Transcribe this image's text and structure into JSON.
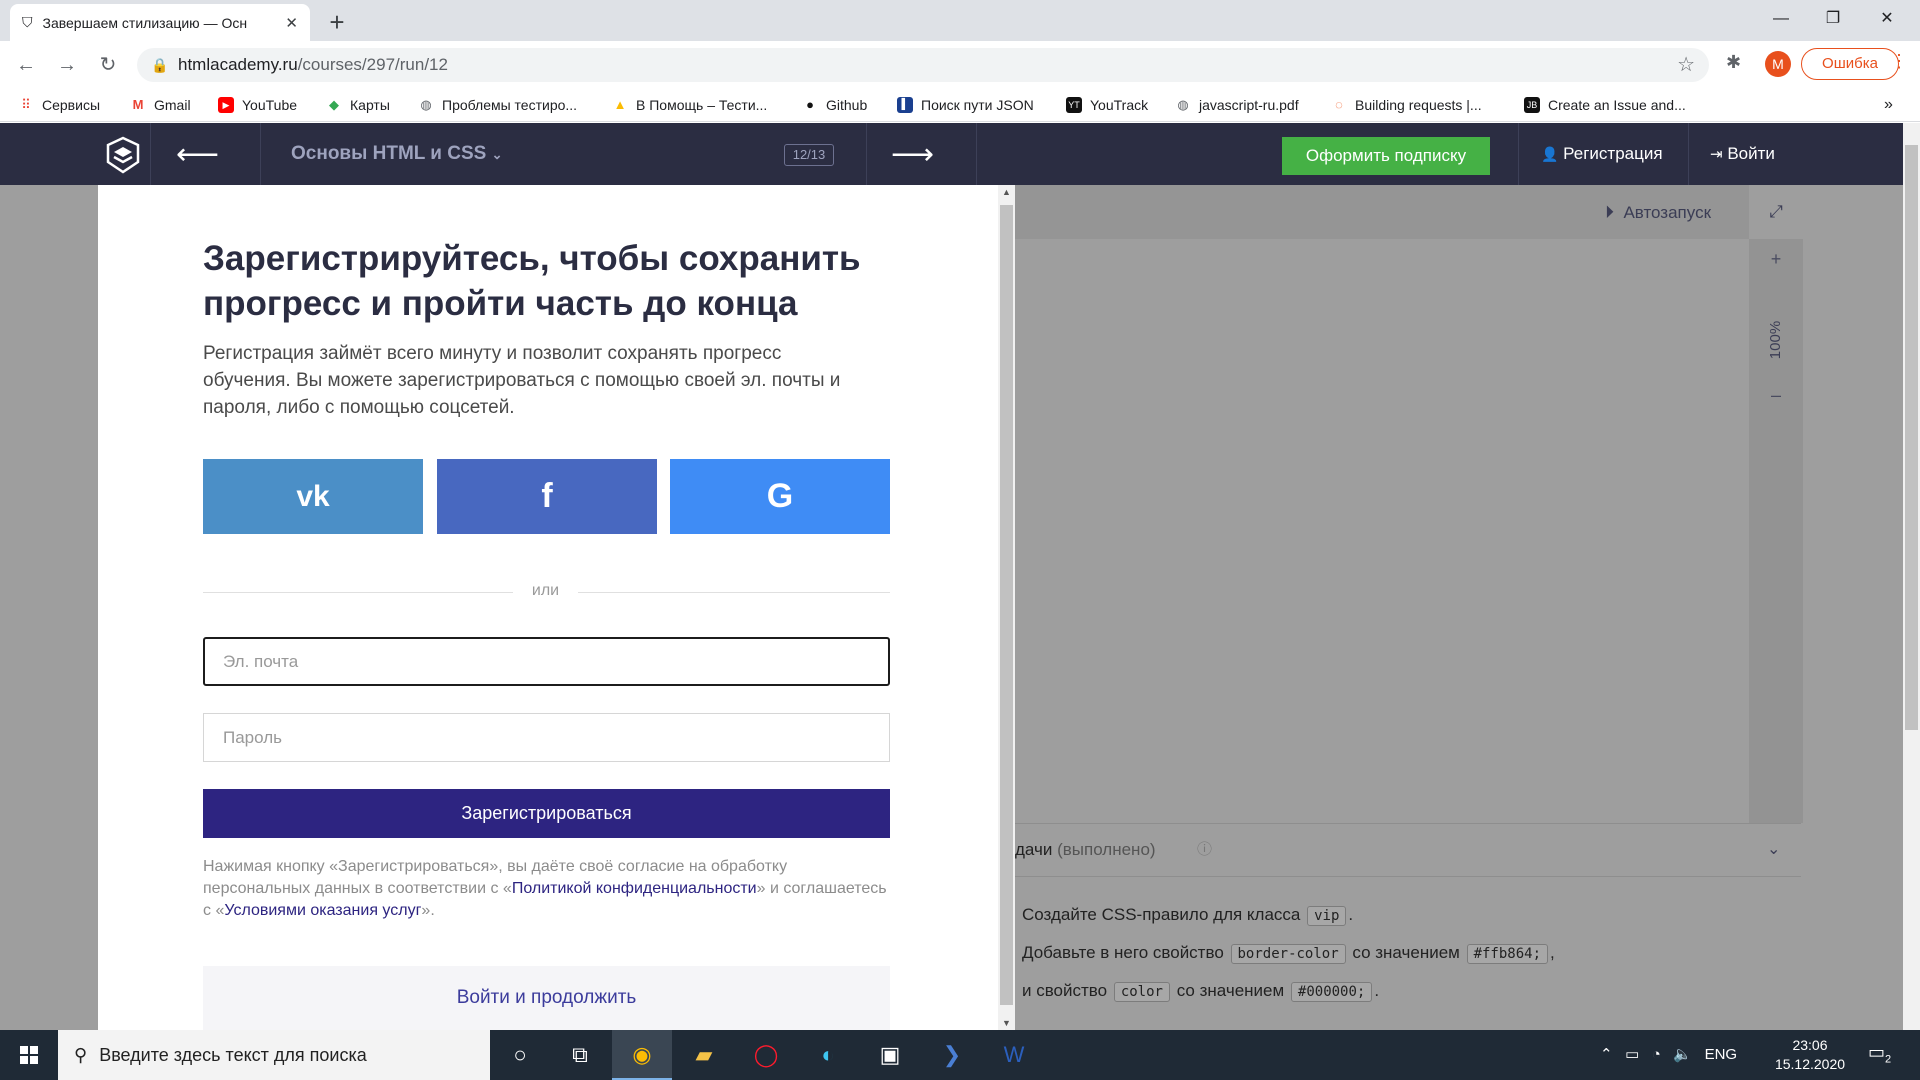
{
  "browser": {
    "tab_title": "Завершаем стилизацию — Осн",
    "url_host": "htmlacademy.ru",
    "url_path": "/courses/297/run/12",
    "profile_initial": "M",
    "error_label": "Ошибка",
    "bookmarks": [
      {
        "label": "Сервисы",
        "icon": "apps-grid-icon"
      },
      {
        "label": "Gmail",
        "icon": "gmail-icon"
      },
      {
        "label": "YouTube",
        "icon": "youtube-icon"
      },
      {
        "label": "Карты",
        "icon": "maps-icon"
      },
      {
        "label": "Проблемы тестиро...",
        "icon": "globe-icon"
      },
      {
        "label": "В Помощь – Тести...",
        "icon": "drive-icon"
      },
      {
        "label": "Github",
        "icon": "github-icon"
      },
      {
        "label": "Поиск пути JSON",
        "icon": "bookmark-icon"
      },
      {
        "label": "YouTrack",
        "icon": "youtrack-icon"
      },
      {
        "label": "javascript-ru.pdf",
        "icon": "globe-icon"
      },
      {
        "label": "Building requests |...",
        "icon": "postman-icon"
      },
      {
        "label": "Create an Issue and...",
        "icon": "jetbrains-icon"
      }
    ],
    "bookmarks_overflow": "»"
  },
  "site_header": {
    "course_title": "Основы HTML и CSS",
    "lesson_counter": "12/13",
    "subscribe_label": "Оформить подписку",
    "register_label": "Регистрация",
    "login_label": "Войти"
  },
  "workspace": {
    "autorun_label": "Автозапуск",
    "zoom_plus": "+",
    "zoom_level": "100%",
    "zoom_minus": "–",
    "task_title": "дачи",
    "task_status": "(выполнено)",
    "task_lines": [
      {
        "parts": [
          "Создайте CSS-правило для класса ",
          "vip",
          "."
        ]
      },
      {
        "parts": [
          "Добавьте в него свойство ",
          "border-color",
          " со значением ",
          "#ffb864;",
          ","
        ]
      },
      {
        "parts": [
          "и свойство ",
          "color",
          " со значением ",
          "#000000;",
          "."
        ]
      }
    ]
  },
  "modal": {
    "title": "Зарегистрируйтесь, чтобы сохранить прогресс и пройти часть до конца",
    "description": "Регистрация займёт всего минуту и позволит сохранять прогресс обучения. Вы можете зарегистрироваться с помощью своей эл. почты и пароля, либо с помощью соцсетей.",
    "social": {
      "vk": "vk",
      "facebook": "f",
      "google": "G"
    },
    "or_label": "или",
    "email_placeholder": "Эл. почта",
    "password_placeholder": "Пароль",
    "register_button": "Зарегистрироваться",
    "consent_prefix": "Нажимая кнопку «Зарегистрироваться», вы даёте своё согласие на обработку персональных данных в соответствии с «",
    "privacy_link": "Политикой конфиденциальности",
    "consent_middle": "» и соглашаетесь с «",
    "terms_link": "Условиями оказания услуг",
    "consent_suffix": "».",
    "login_continue": "Войти и продолжить"
  },
  "taskbar": {
    "search_placeholder": "Введите здесь текст для поиска",
    "language": "ENG",
    "time": "23:06",
    "date": "15.12.2020",
    "notifications": "2"
  },
  "colors": {
    "header_bg": "#2b2d42",
    "subscribe_green": "#45b145",
    "register_button": "#2d2481",
    "vk": "#4b8fc7",
    "facebook": "#4868c0",
    "google": "#3f8cf5"
  }
}
